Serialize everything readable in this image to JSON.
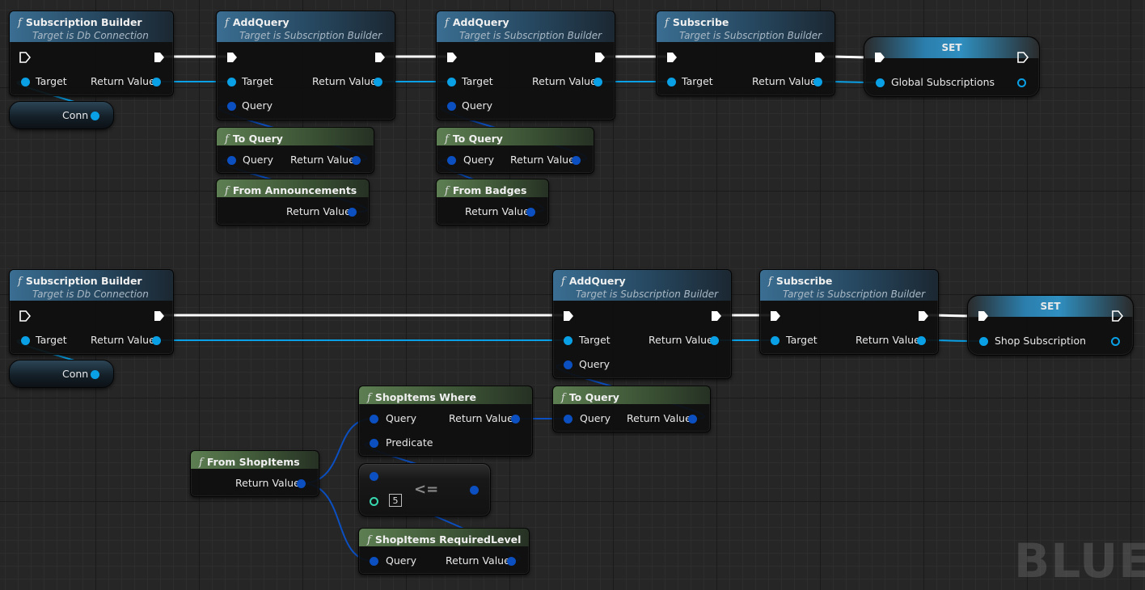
{
  "watermark": "BLUEP",
  "icons": {
    "function": "f",
    "exec": "exec-pin-icon",
    "data_pin": "data-pin-icon"
  },
  "colors": {
    "exec_wire": "#ffffff",
    "object_wire": "#0aa0e6",
    "struct_wire": "#0b4fc0",
    "int_pin": "#38d8b0"
  },
  "top_chain": {
    "builder": {
      "title": "Subscription Builder",
      "subtitle": "Target is Db Connection",
      "target": "Target",
      "return": "Return Value"
    },
    "conn": {
      "label": "Conn"
    },
    "addquery1": {
      "title": "AddQuery",
      "subtitle": "Target is Subscription Builder",
      "target": "Target",
      "return": "Return Value",
      "query": "Query"
    },
    "addquery2": {
      "title": "AddQuery",
      "subtitle": "Target is Subscription Builder",
      "target": "Target",
      "return": "Return Value",
      "query": "Query"
    },
    "subscribe": {
      "title": "Subscribe",
      "subtitle": "Target is Subscription Builder",
      "target": "Target",
      "return": "Return Value"
    },
    "set": {
      "title": "SET",
      "var": "Global Subscriptions"
    },
    "toquery1": {
      "title": "To Query",
      "query": "Query",
      "return": "Return Value"
    },
    "toquery2": {
      "title": "To Query",
      "query": "Query",
      "return": "Return Value"
    },
    "from_announcements": {
      "title": "From Announcements",
      "return": "Return Value"
    },
    "from_badges": {
      "title": "From Badges",
      "return": "Return Value"
    }
  },
  "bottom_chain": {
    "builder": {
      "title": "Subscription Builder",
      "subtitle": "Target is Db Connection",
      "target": "Target",
      "return": "Return Value"
    },
    "conn": {
      "label": "Conn"
    },
    "addquery": {
      "title": "AddQuery",
      "subtitle": "Target is Subscription Builder",
      "target": "Target",
      "return": "Return Value",
      "query": "Query"
    },
    "subscribe": {
      "title": "Subscribe",
      "subtitle": "Target is Subscription Builder",
      "target": "Target",
      "return": "Return Value"
    },
    "set": {
      "title": "SET",
      "var": "Shop Subscription"
    },
    "toquery": {
      "title": "To Query",
      "query": "Query",
      "return": "Return Value"
    },
    "where": {
      "title": "ShopItems Where",
      "query": "Query",
      "return": "Return Value",
      "predicate": "Predicate"
    },
    "from_shopitems": {
      "title": "From ShopItems",
      "return": "Return Value"
    },
    "lte": {
      "operator": "<=",
      "value": "5"
    },
    "required_level": {
      "title": "ShopItems RequiredLevel",
      "query": "Query",
      "return": "Return Value"
    }
  }
}
